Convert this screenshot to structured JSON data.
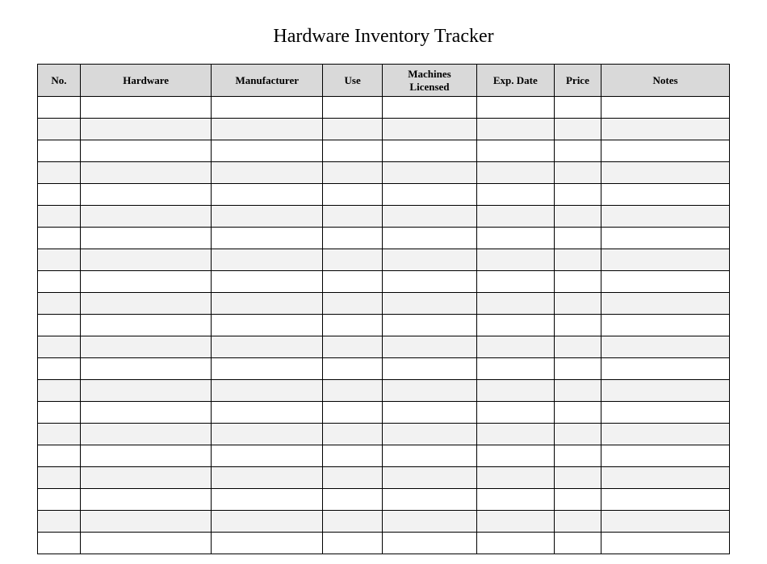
{
  "title": "Hardware Inventory Tracker",
  "columns": [
    {
      "label": "No."
    },
    {
      "label": "Hardware"
    },
    {
      "label": "Manufacturer"
    },
    {
      "label": "Use"
    },
    {
      "label": "Machines\nLicensed"
    },
    {
      "label": "Exp. Date"
    },
    {
      "label": "Price"
    },
    {
      "label": "Notes"
    }
  ],
  "row_count": 21
}
